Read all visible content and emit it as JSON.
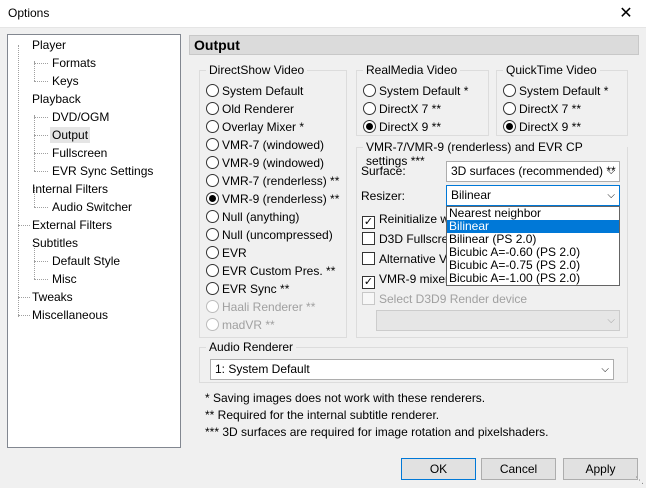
{
  "window": {
    "title": "Options",
    "close_glyph": "✕"
  },
  "tree": [
    {
      "label": "Player"
    },
    {
      "label": "Formats"
    },
    {
      "label": "Keys"
    },
    {
      "label": "Playback"
    },
    {
      "label": "DVD/OGM"
    },
    {
      "label": "Output"
    },
    {
      "label": "Fullscreen"
    },
    {
      "label": "EVR Sync Settings"
    },
    {
      "label": "Internal Filters"
    },
    {
      "label": "Audio Switcher"
    },
    {
      "label": "External Filters"
    },
    {
      "label": "Subtitles"
    },
    {
      "label": "Default Style"
    },
    {
      "label": "Misc"
    },
    {
      "label": "Tweaks"
    },
    {
      "label": "Miscellaneous"
    }
  ],
  "page_title": "Output",
  "directshow": {
    "title": "DirectShow Video",
    "options": [
      {
        "label": "System Default",
        "checked": false,
        "enabled": true
      },
      {
        "label": "Old Renderer",
        "checked": false,
        "enabled": true
      },
      {
        "label": "Overlay Mixer *",
        "checked": false,
        "enabled": true
      },
      {
        "label": "VMR-7 (windowed)",
        "checked": false,
        "enabled": true
      },
      {
        "label": "VMR-9 (windowed)",
        "checked": false,
        "enabled": true
      },
      {
        "label": "VMR-7 (renderless) **",
        "checked": false,
        "enabled": true
      },
      {
        "label": "VMR-9 (renderless) **",
        "checked": true,
        "enabled": true
      },
      {
        "label": "Null (anything)",
        "checked": false,
        "enabled": true
      },
      {
        "label": "Null (uncompressed)",
        "checked": false,
        "enabled": true
      },
      {
        "label": "EVR",
        "checked": false,
        "enabled": true
      },
      {
        "label": "EVR Custom Pres. **",
        "checked": false,
        "enabled": true
      },
      {
        "label": "EVR Sync **",
        "checked": false,
        "enabled": true
      },
      {
        "label": "Haali Renderer **",
        "checked": false,
        "enabled": false
      },
      {
        "label": "madVR **",
        "checked": false,
        "enabled": false
      }
    ]
  },
  "realmedia": {
    "title": "RealMedia Video",
    "options": [
      {
        "label": "System Default *",
        "checked": false
      },
      {
        "label": "DirectX 7 **",
        "checked": false
      },
      {
        "label": "DirectX 9 **",
        "checked": true
      }
    ]
  },
  "quicktime": {
    "title": "QuickTime Video",
    "options": [
      {
        "label": "System Default *",
        "checked": false
      },
      {
        "label": "DirectX 7 **",
        "checked": false
      },
      {
        "label": "DirectX 9 **",
        "checked": true
      }
    ]
  },
  "vmr": {
    "title": "VMR-7/VMR-9 (renderless) and EVR CP settings ***",
    "surface_label": "Surface:",
    "surface_value": "3D surfaces (recommended) **",
    "resizer_label": "Resizer:",
    "resizer_value": "Bilinear",
    "resizer_options": [
      "Nearest neighbor",
      "Bilinear",
      "Bilinear (PS 2.0)",
      "Bicubic A=-0.60 (PS 2.0)",
      "Bicubic A=-0.75 (PS 2.0)",
      "Bicubic A=-1.00 (PS 2.0)"
    ],
    "resizer_selected_index": 1,
    "checks": [
      {
        "label": "Reinitialize whe",
        "checked": true,
        "enabled": true
      },
      {
        "label": "D3D Fullscree",
        "checked": false,
        "enabled": true
      },
      {
        "label": "Alternative VS",
        "checked": false,
        "enabled": true
      },
      {
        "label": "VMR-9 mixer m",
        "checked": true,
        "enabled": true
      },
      {
        "label": "Select D3D9 Render device",
        "checked": false,
        "enabled": false
      }
    ],
    "device_value": ""
  },
  "audio": {
    "title": "Audio Renderer",
    "value": "1: System Default"
  },
  "notes": [
    "* Saving images does not work with these renderers.",
    "** Required for the internal subtitle renderer.",
    "*** 3D surfaces are required for image rotation and pixelshaders."
  ],
  "buttons": {
    "ok": "OK",
    "cancel": "Cancel",
    "apply": "Apply"
  },
  "colors": {
    "accent": "#0078d7",
    "header_bg": "#dbdbdb",
    "window_bg": "#f0f0f0"
  }
}
